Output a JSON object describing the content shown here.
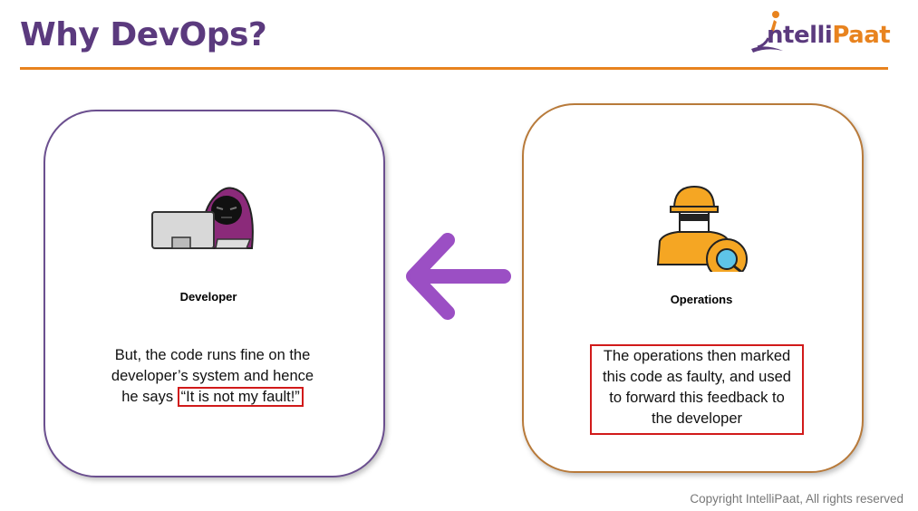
{
  "slide": {
    "title": "Why DevOps?",
    "footer": "Copyright IntelliPaat, All rights reserved"
  },
  "logo": {
    "part1": "ntelli",
    "part2": "Paat"
  },
  "developer": {
    "label": "Developer",
    "text_line1": "But, the code runs fine on the",
    "text_line2": "developer’s system and hence",
    "text_line3_prefix": "he says ",
    "text_quote": "“It is not my fault!”"
  },
  "operations": {
    "label": "Operations",
    "text_line1": "The operations then marked",
    "text_line2": "this code as faulty, and used",
    "text_line3": "to forward this feedback to",
    "text_line4": "the developer"
  },
  "colors": {
    "title": "#5b3a7e",
    "accent": "#e8831f",
    "arrow": "#9b4fc4",
    "highlight": "#d11a1a"
  },
  "icons": [
    "intellipaat-logo-icon",
    "developer-icon",
    "operations-icon",
    "left-arrow-icon"
  ]
}
